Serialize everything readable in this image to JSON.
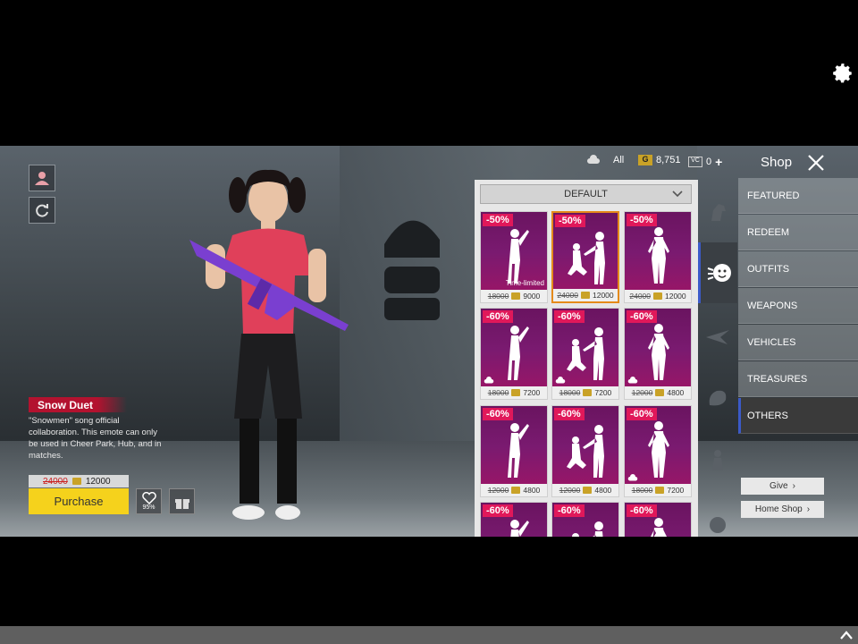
{
  "item": {
    "name": "Snow Duet",
    "description": "\"Snowmen\" song official collaboration. This emote can only be used in Cheer Park, Hub, and in matches.",
    "old_price": "24000",
    "price": "12000",
    "purchase_label": "Purchase",
    "likes": "95%"
  },
  "topbar": {
    "filter_label": "All",
    "gold": "8,751",
    "vc": "0"
  },
  "shop": {
    "title": "Shop",
    "dropdown": "DEFAULT"
  },
  "cards": [
    {
      "discount": "-50%",
      "old": "18000",
      "price": "9000",
      "tag": "Time-limited",
      "cloud": false,
      "selected": false
    },
    {
      "discount": "-50%",
      "old": "24000",
      "price": "12000",
      "tag": "",
      "cloud": false,
      "selected": true
    },
    {
      "discount": "-50%",
      "old": "24000",
      "price": "12000",
      "tag": "",
      "cloud": false,
      "selected": false
    },
    {
      "discount": "-60%",
      "old": "18000",
      "price": "7200",
      "tag": "",
      "cloud": true,
      "selected": false
    },
    {
      "discount": "-60%",
      "old": "18000",
      "price": "7200",
      "tag": "",
      "cloud": true,
      "selected": false
    },
    {
      "discount": "-60%",
      "old": "12000",
      "price": "4800",
      "tag": "",
      "cloud": true,
      "selected": false
    },
    {
      "discount": "-60%",
      "old": "12000",
      "price": "4800",
      "tag": "",
      "cloud": false,
      "selected": false
    },
    {
      "discount": "-60%",
      "old": "12000",
      "price": "4800",
      "tag": "",
      "cloud": false,
      "selected": false
    },
    {
      "discount": "-60%",
      "old": "18000",
      "price": "7200",
      "tag": "",
      "cloud": true,
      "selected": false
    },
    {
      "discount": "-60%",
      "old": "",
      "price": "",
      "tag": "",
      "cloud": false,
      "selected": false
    },
    {
      "discount": "-60%",
      "old": "",
      "price": "",
      "tag": "",
      "cloud": false,
      "selected": false
    },
    {
      "discount": "-60%",
      "old": "",
      "price": "",
      "tag": "",
      "cloud": false,
      "selected": false
    }
  ],
  "menu": [
    {
      "label": "FEATURED",
      "active": false
    },
    {
      "label": "REDEEM",
      "active": false
    },
    {
      "label": "OUTFITS",
      "active": false
    },
    {
      "label": "WEAPONS",
      "active": false
    },
    {
      "label": "VEHICLES",
      "active": false
    },
    {
      "label": "TREASURES",
      "active": false
    },
    {
      "label": "OTHERS",
      "active": true
    }
  ],
  "category_icons": [
    "horse-icon",
    "emote-icon",
    "glider-icon",
    "pet-icon",
    "figure-icon",
    "misc-icon"
  ],
  "buttons": {
    "give": "Give",
    "home_shop": "Home Shop"
  },
  "colors": {
    "accent_blue": "#3b5ac8",
    "discount": "#e0185a",
    "purchase": "#f5d21c",
    "item_name_bg": "#b3122f"
  }
}
